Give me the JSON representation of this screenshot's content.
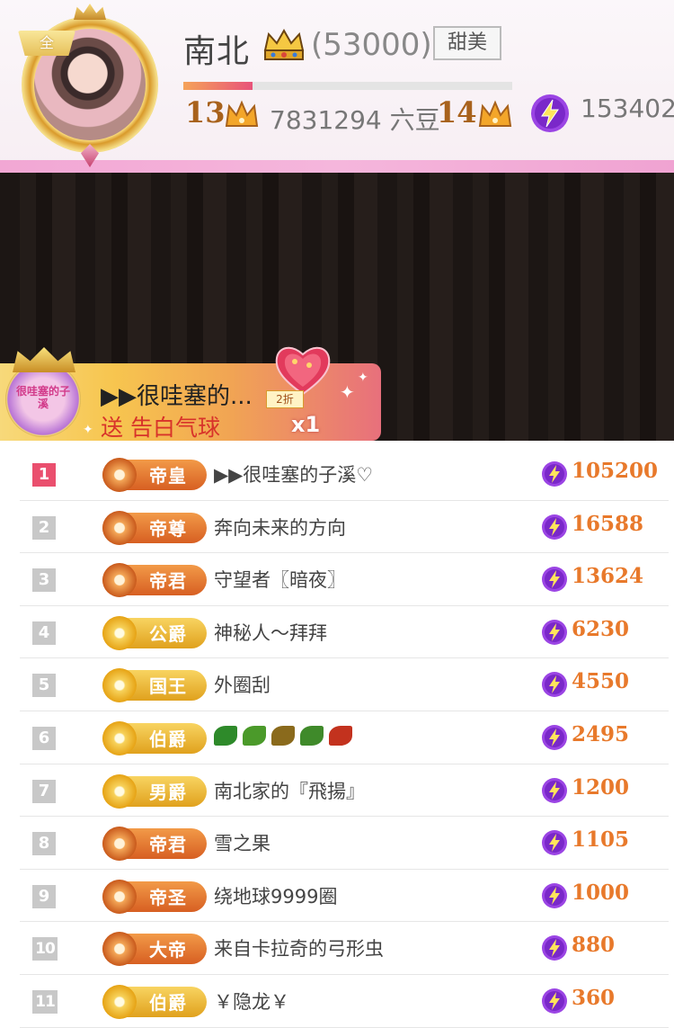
{
  "anchor": {
    "name": "南北",
    "score": "(53000)",
    "tag": "甜美",
    "avatar_badge": "全",
    "progress_fraction": 0.21,
    "level_current": "13",
    "beans": "7831294 六豆",
    "level_next": "14",
    "coins": "153402"
  },
  "gift_banner": {
    "user": "▶▶很哇塞的...",
    "action": "送 告白气球",
    "discount": "2折",
    "count": "x1",
    "avatar_text": "很哇塞的子溪"
  },
  "rankings": [
    {
      "rank": "1",
      "badge": "帝皇",
      "name": "▶▶很哇塞的子溪♡",
      "amount": "105200",
      "style": "orange"
    },
    {
      "rank": "2",
      "badge": "帝尊",
      "name": "奔向未来的方向",
      "amount": "16588",
      "style": "orange"
    },
    {
      "rank": "3",
      "badge": "帝君",
      "name": "守望者〖暗夜〗",
      "amount": "13624",
      "style": "orange"
    },
    {
      "rank": "4",
      "badge": "公爵",
      "name": "神秘人～拜拜",
      "amount": "6230",
      "style": "gold"
    },
    {
      "rank": "5",
      "badge": "国王",
      "name": "外圈刮",
      "amount": "4550",
      "style": "gold"
    },
    {
      "rank": "6",
      "badge": "伯爵",
      "name": "",
      "amount": "2495",
      "style": "gold",
      "emoji": [
        "clover-icon",
        "leaf-icon",
        "sprout-icon",
        "pea-pod-icon",
        "maple-leaf-icon"
      ]
    },
    {
      "rank": "7",
      "badge": "男爵",
      "name": "南北家的『飛揚』",
      "amount": "1200",
      "style": "gold"
    },
    {
      "rank": "8",
      "badge": "帝君",
      "name": "雪之果",
      "amount": "1105",
      "style": "orange"
    },
    {
      "rank": "9",
      "badge": "帝圣",
      "name": "绕地球9999圈",
      "amount": "1000",
      "style": "orange"
    },
    {
      "rank": "10",
      "badge": "大帝",
      "name": "来自卡拉奇的弓形虫",
      "amount": "880",
      "style": "orange"
    },
    {
      "rank": "11",
      "badge": "伯爵",
      "name": "￥隐龙￥",
      "amount": "360",
      "style": "gold"
    }
  ],
  "colors": {
    "accent_orange": "#e8792b",
    "rank_first": "#ea4f6e",
    "bolt_purple": "#8a35d8"
  }
}
